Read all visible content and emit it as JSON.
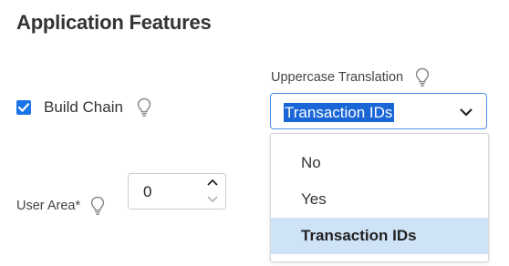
{
  "section": {
    "title": "Application Features"
  },
  "build_chain": {
    "label": "Build Chain",
    "checked": true,
    "icon": "lightbulb-icon"
  },
  "uppercase_translation": {
    "label": "Uppercase Translation",
    "icon": "lightbulb-icon",
    "selected_value": "Transaction IDs",
    "options": [
      "No",
      "Yes",
      "Transaction IDs"
    ]
  },
  "user_area": {
    "label": "User Area*",
    "icon": "lightbulb-icon",
    "value": "0"
  },
  "colors": {
    "accent": "#1a73e8",
    "selection_highlight": "#1a66d6",
    "option_selected_bg": "#cfe3f7",
    "focus_border": "#4a90e2"
  }
}
